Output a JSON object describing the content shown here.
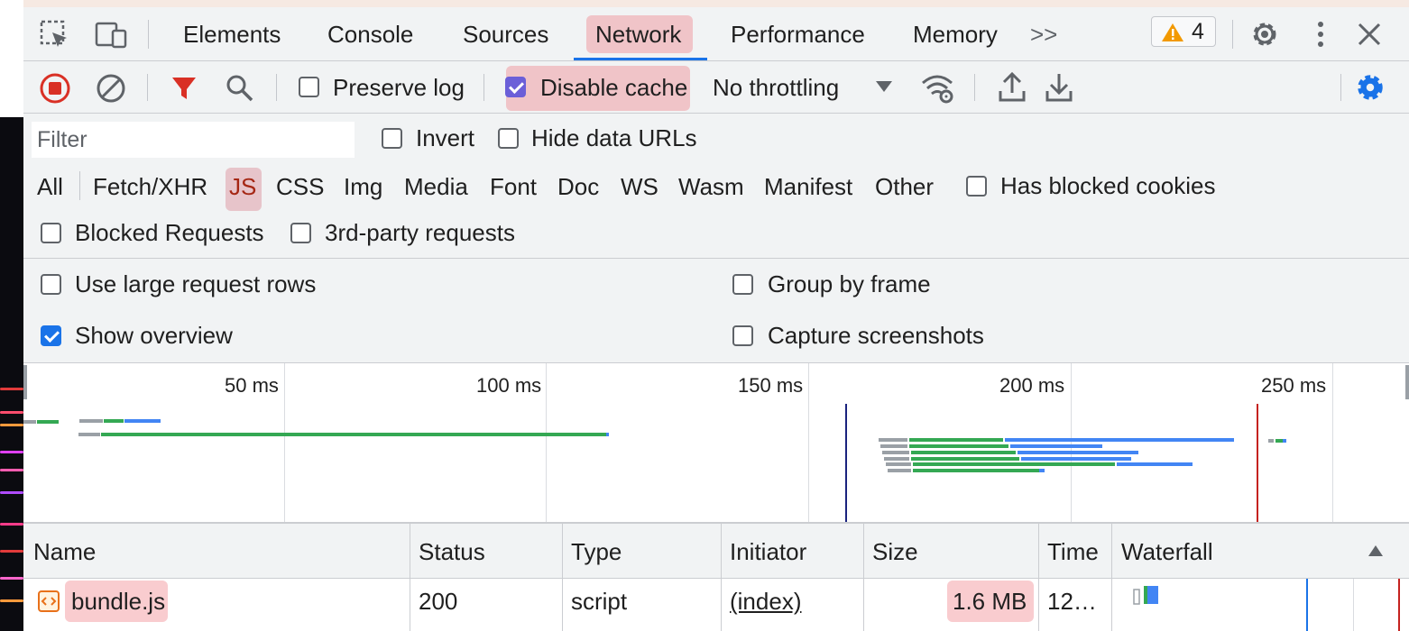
{
  "devtools": {
    "tabs": [
      "Elements",
      "Console",
      "Sources",
      "Network",
      "Performance",
      "Memory"
    ],
    "active_tab": "Network",
    "more_tabs": ">>",
    "warnings_count": "4"
  },
  "toolbar": {
    "preserve_log": {
      "label": "Preserve log",
      "checked": false
    },
    "disable_cache": {
      "label": "Disable cache",
      "checked": true
    },
    "throttling": "No throttling"
  },
  "filter": {
    "placeholder": "Filter",
    "invert": {
      "label": "Invert",
      "checked": false
    },
    "hide_data_urls": {
      "label": "Hide data URLs",
      "checked": false
    },
    "types": [
      "All",
      "Fetch/XHR",
      "JS",
      "CSS",
      "Img",
      "Media",
      "Font",
      "Doc",
      "WS",
      "Wasm",
      "Manifest",
      "Other"
    ],
    "active_type": "JS",
    "has_blocked_cookies": {
      "label": "Has blocked cookies",
      "checked": false
    },
    "blocked_requests": {
      "label": "Blocked Requests",
      "checked": false
    },
    "third_party": {
      "label": "3rd-party requests",
      "checked": false
    }
  },
  "settings": {
    "large_rows": {
      "label": "Use large request rows",
      "checked": false
    },
    "group_by_frame": {
      "label": "Group by frame",
      "checked": false
    },
    "show_overview": {
      "label": "Show overview",
      "checked": true
    },
    "capture_screenshots": {
      "label": "Capture screenshots",
      "checked": false
    }
  },
  "overview": {
    "ticks": [
      "50 ms",
      "100 ms",
      "150 ms",
      "200 ms",
      "250 ms"
    ]
  },
  "table": {
    "columns": [
      "Name",
      "Status",
      "Type",
      "Initiator",
      "Size",
      "Time",
      "Waterfall"
    ],
    "rows": [
      {
        "name": "bundle.js",
        "status": "200",
        "type": "script",
        "initiator": "(index)",
        "size": "1.6 MB",
        "time": "12…"
      }
    ]
  },
  "colors": {
    "accent": "#1a73e8",
    "record": "#d93025",
    "highlight": "#f0a0a8",
    "bar_green": "#34a853",
    "bar_blue": "#4285f4",
    "bar_gray": "#9aa0a6"
  }
}
